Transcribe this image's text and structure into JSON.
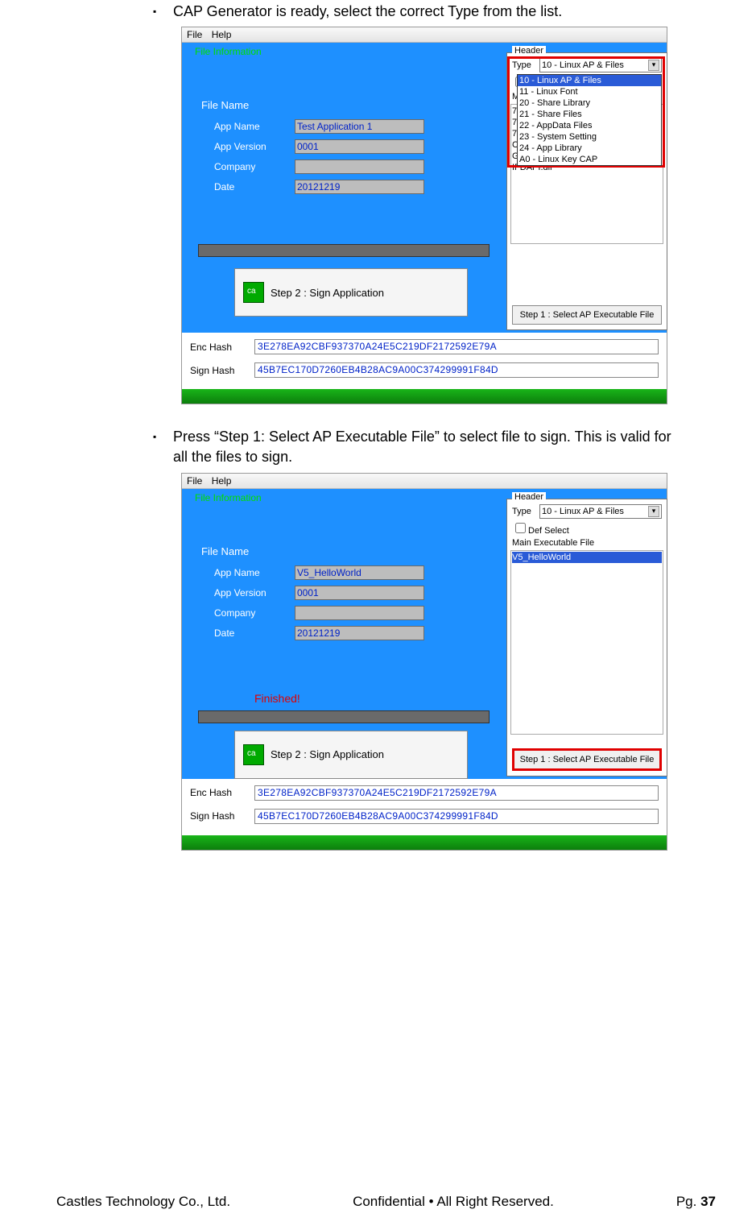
{
  "bullet1": "CAP Generator is ready, select the correct Type from the list.",
  "bullet2": "Press “Step 1: Select AP Executable File” to select file to sign. This is valid for all the files to sign.",
  "menubar": {
    "file": "File",
    "help": "Help"
  },
  "panel": {
    "file_information": "File Information",
    "file_name": "File Name",
    "app_name_label": "App Name",
    "app_version_label": "App Version",
    "company_label": "Company",
    "date_label": "Date",
    "step2": "Step 2 : Sign Application",
    "finished": "Finished!"
  },
  "win1": {
    "app_name": "Test Application 1",
    "app_version": "0001",
    "company": "",
    "date": "20121219"
  },
  "win2": {
    "app_name": "V5_HelloWorld",
    "app_version": "0001",
    "company": "",
    "date": "20121219"
  },
  "header": {
    "title": "Header",
    "type_label": "Type",
    "type_value": "10 - Linux AP & Files",
    "def_select": "Def Select",
    "main_exec": "Main Executable File",
    "step1": "Step 1 : Select AP Executable File"
  },
  "dropdown": {
    "selected": "10 - Linux AP & Files",
    "items": [
      "10 - Linux AP & Files",
      "11 - Linux Font",
      "20 - Share Library",
      "21 - Share Files",
      "22 - AppData Files",
      "23 - System Setting",
      "24 - App Library",
      "A0 - Linux Key CAP"
    ]
  },
  "filelist1": [
    "7z.dll",
    "7z.sfx",
    "7-zip.dll",
    "CAProg.exe",
    "GPKI.dll",
    "IFDAPI.dll"
  ],
  "filelist2": [
    "V5_HelloWorld"
  ],
  "hash": {
    "enc_label": "Enc Hash",
    "sign_label": "Sign Hash",
    "enc_value": "3E278EA92CBF937370A24E5C219DF2172592E79A",
    "sign_value": "45B7EC170D7260EB4B28AC9A00C374299991F84D"
  },
  "footer": {
    "company": "Castles Technology Co., Ltd.",
    "mid": "Confidential • All Right Reserved.",
    "pg_label": "Pg. ",
    "pg_num": "37"
  }
}
